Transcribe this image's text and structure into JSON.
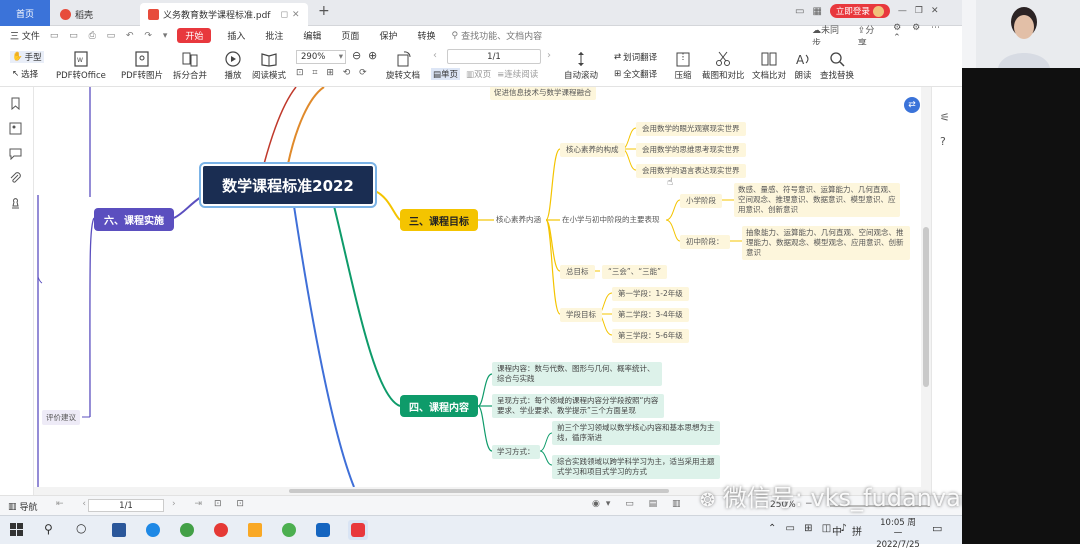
{
  "tabs": {
    "home": "首页",
    "draft": "稻壳",
    "doc": "义务教育数学课程标准.pdf"
  },
  "titlebar_right": {
    "login": "立即登录"
  },
  "menu": {
    "file": "三 文件",
    "items": [
      "开始",
      "插入",
      "批注",
      "编辑",
      "页面",
      "保护",
      "转换"
    ],
    "search": "查找功能、文档内容",
    "sync": "未同步",
    "share": "分享"
  },
  "ribbon": {
    "hand": "手型",
    "select": "选择",
    "pdf_to_office": "PDF转Office",
    "pdf_to_image": "PDF转图片",
    "split_merge": "拆分合并",
    "play": "播放",
    "read_mode": "阅读模式",
    "zoom": "290%",
    "page_input": "1/1",
    "rotate": "旋转文档",
    "single": "单页",
    "double": "双页",
    "continuous": "连续阅读",
    "auto_scroll": "自动滚动",
    "translate_word": "划词翻译",
    "translate_full": "全文翻译",
    "compress": "压缩",
    "screenshot": "截图和对比",
    "compare": "文档比对",
    "read_aloud": "朗读",
    "find_replace": "查找替换"
  },
  "mindmap": {
    "center": "数学课程标准2022",
    "top_node": "促进信息技术与数学课程融合",
    "sec3": {
      "title": "三、课程目标",
      "core": "核心素养内涵",
      "composition": "核心素养的构成",
      "comp_items": [
        "会用数学的眼光观察现实世界",
        "会用数学的思维思考现实世界",
        "会用数学的语言表达现实世界"
      ],
      "stage_label": "在小学与初中阶段的主要表现",
      "primary": "小学阶段",
      "primary_text": "数感、量感、符号意识、运算能力、几何直观、空间观念、推理意识、数据意识、模型意识、应用意识、创新意识",
      "middle": "初中阶段：",
      "middle_text": "抽象能力、运算能力、几何直观、空间观念、推理能力、数据观念、模型观念、应用意识、创新意识",
      "total_goal": "总目标",
      "total_goal_text": "“三会”、“三能”",
      "stage_goal": "学段目标",
      "stages": [
        "第一学段：1-2年级",
        "第二学段：3-4年级",
        "第三学段：5-6年级"
      ]
    },
    "sec4": {
      "title": "四、课程内容",
      "content": "课程内容：数与代数、图形与几何、概率统计、综合与实践",
      "presentation": "呈现方式：每个领域的课程内容分学段按照“内容要求、学业要求、教学提示”三个方面呈现",
      "learning": "学习方式：",
      "learn_items": [
        "前三个学习领域以数学核心内容和基本思想为主线，循序渐进",
        "综合实践领域以跨学科学习为主，适当采用主题式学习和项目式学习的方式"
      ]
    },
    "sec6": {
      "title": "六、课程实施"
    },
    "eval": "评价建议"
  },
  "status": {
    "nav": "导航",
    "page": "1/1",
    "zoom": "250%"
  },
  "taskbar": {
    "time": "10:05 周一",
    "date": "2022/7/25",
    "ime": "中",
    "ime2": "拼"
  },
  "watermark": "微信号: vks_fudanvanke",
  "colors": {
    "accent_red": "#e8383d",
    "tab_blue": "#3b73d9",
    "center_bg": "#1a2d52",
    "sec3": "#f4c400",
    "sec4": "#0e9b6a",
    "sec6": "#5b4fbf"
  }
}
